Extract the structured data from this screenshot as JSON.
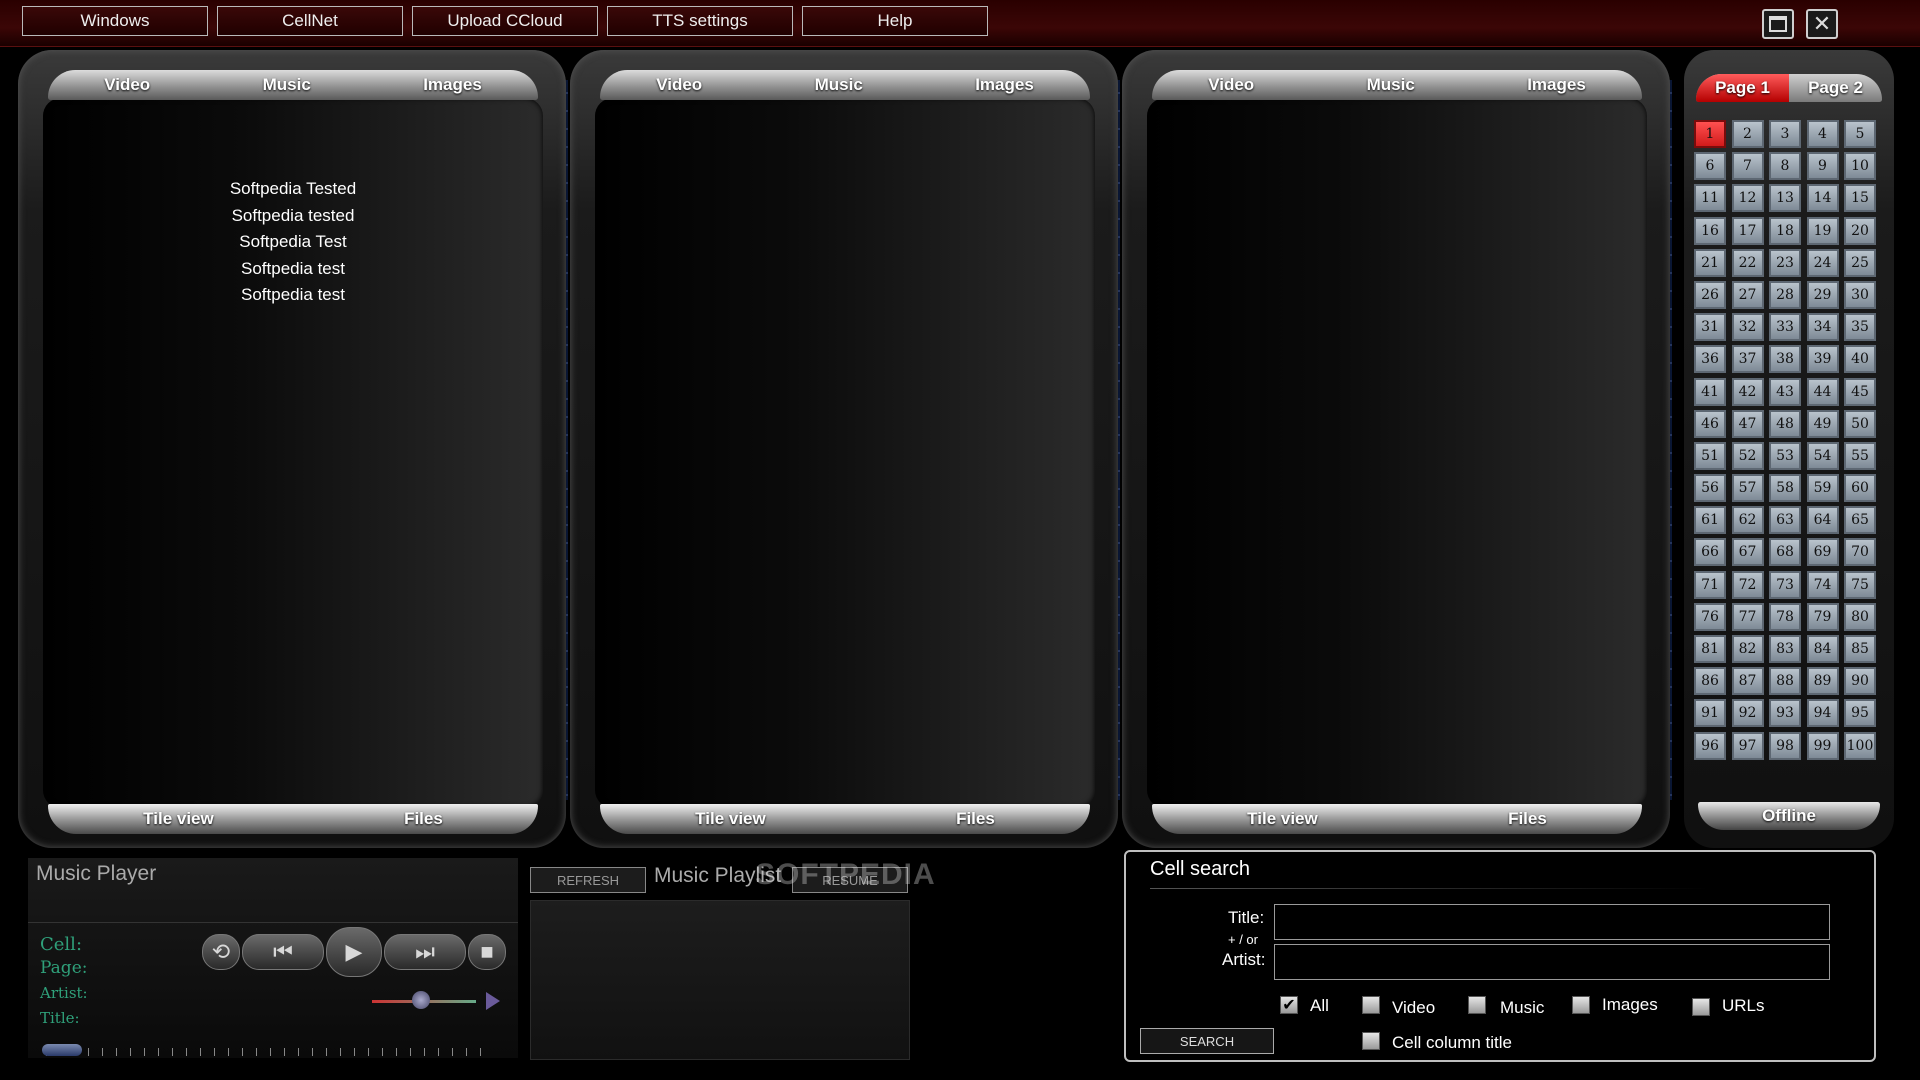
{
  "menu": [
    "Windows",
    "CellNet",
    "Upload CCloud",
    "TTS settings",
    "Help"
  ],
  "panels": [
    {
      "tabs": [
        "Video",
        "Music",
        "Images"
      ],
      "bottom": [
        "Tile view",
        "Files"
      ],
      "items": [
        "Softpedia Tested",
        "Softpedia tested",
        "Softpedia Test",
        "Softpedia test",
        "Softpedia test"
      ]
    },
    {
      "tabs": [
        "Video",
        "Music",
        "Images"
      ],
      "bottom": [
        "Tile view",
        "Files"
      ],
      "items": []
    },
    {
      "tabs": [
        "Video",
        "Music",
        "Images"
      ],
      "bottom": [
        "Tile view",
        "Files"
      ],
      "items": []
    }
  ],
  "pages": {
    "tabs": [
      "Page 1",
      "Page 2"
    ],
    "active_tab": 0,
    "active_cell": 1,
    "cell_count": 100,
    "status": "Offline"
  },
  "player": {
    "title": "Music Player",
    "labels": {
      "cell": "Cell:",
      "page": "Page:",
      "artist": "Artist:",
      "title": "Title:"
    }
  },
  "playlist": {
    "title": "Music Playlist",
    "refresh": "REFRESH",
    "resume": "RESUME"
  },
  "watermark": "SOFTPEDIA",
  "search": {
    "title": "Cell search",
    "title_label": "Title:",
    "or_label": "+ / or",
    "artist_label": "Artist:",
    "filters": [
      "All",
      "Video",
      "Music",
      "Images",
      "URLs"
    ],
    "filter_checked": [
      true,
      false,
      false,
      false,
      false
    ],
    "cell_column_title": "Cell column title",
    "button": "SEARCH"
  },
  "colors": {
    "accent": "#d11b1b",
    "topbar": "#3b0606",
    "label_green": "#2fa07a"
  }
}
